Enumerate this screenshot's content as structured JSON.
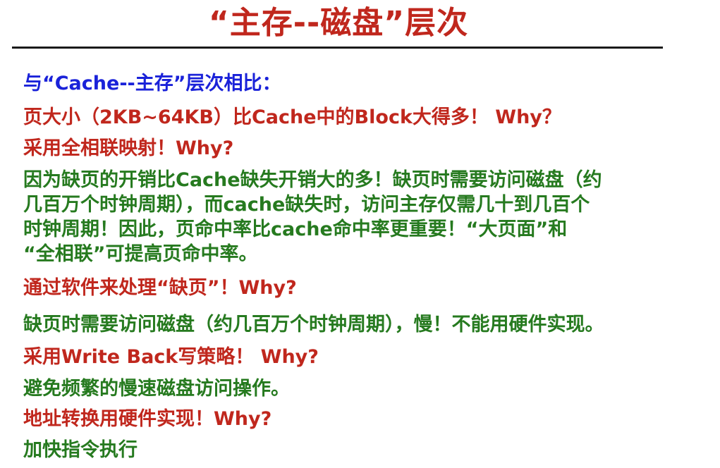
{
  "title": "“主存--磁盘”层次",
  "lines": {
    "intro": "与“Cache--主存”层次相比：",
    "q1": "页大小（2KB~64KB）比Cache中的Block大得多！ Why？",
    "q2": "采用全相联映射！Why?",
    "a2": [
      "因为缺页的开销比Cache缺失开销大的多！缺页时需要访问磁盘（约",
      "几百万个时钟周期），而cache缺失时，访问主存仅需几十到几百个",
      "时钟周期！因此，页命中率比cache命中率更重要！“大页面”和",
      "“全相联”可提高页命中率。"
    ],
    "q3": "通过软件来处理“缺页”！Why?",
    "a3": "缺页时需要访问磁盘（约几百万个时钟周期），慢！不能用硬件实现。",
    "q4": "采用Write Back写策略！ Why?",
    "a4": "避免频繁的慢速磁盘访问操作。",
    "q5": "地址转换用硬件实现！Why?",
    "a5": "加快指令执行"
  },
  "colors": {
    "title": "#c0271d",
    "intro": "#1a22d9",
    "question": "#c0271d",
    "answer": "#267a1f",
    "rule": "#1a1a1a"
  }
}
